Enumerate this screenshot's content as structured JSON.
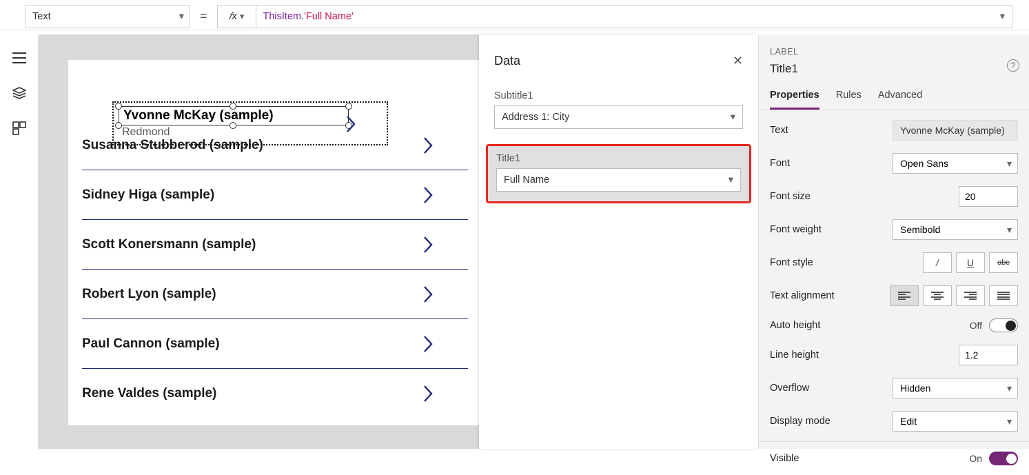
{
  "formula": {
    "property": "Text",
    "thisItem": "ThisItem",
    "dot": ".",
    "member": "'Full Name'"
  },
  "gallery": {
    "selected": {
      "title": "Yvonne McKay (sample)",
      "subtitle": "Redmond"
    },
    "items": [
      "Susanna Stubberod (sample)",
      "Sidney Higa (sample)",
      "Scott Konersmann (sample)",
      "Robert Lyon (sample)",
      "Paul Cannon (sample)",
      "Rene Valdes (sample)"
    ]
  },
  "dataPanel": {
    "title": "Data",
    "subtitle1Label": "Subtitle1",
    "subtitle1Value": "Address 1: City",
    "title1Label": "Title1",
    "title1Value": "Full Name"
  },
  "propsPanel": {
    "kind": "LABEL",
    "name": "Title1",
    "tabs": {
      "properties": "Properties",
      "rules": "Rules",
      "advanced": "Advanced"
    },
    "text": {
      "label": "Text",
      "value": "Yvonne McKay (sample)"
    },
    "font": {
      "label": "Font",
      "value": "Open Sans"
    },
    "fontSize": {
      "label": "Font size",
      "value": "20"
    },
    "fontWeight": {
      "label": "Font weight",
      "value": "Semibold"
    },
    "fontStyle": {
      "label": "Font style"
    },
    "textAlign": {
      "label": "Text alignment"
    },
    "autoHeight": {
      "label": "Auto height",
      "state": "Off"
    },
    "lineHeight": {
      "label": "Line height",
      "value": "1.2"
    },
    "overflow": {
      "label": "Overflow",
      "value": "Hidden"
    },
    "displayMode": {
      "label": "Display mode",
      "value": "Edit"
    },
    "visible": {
      "label": "Visible",
      "state": "On"
    }
  }
}
